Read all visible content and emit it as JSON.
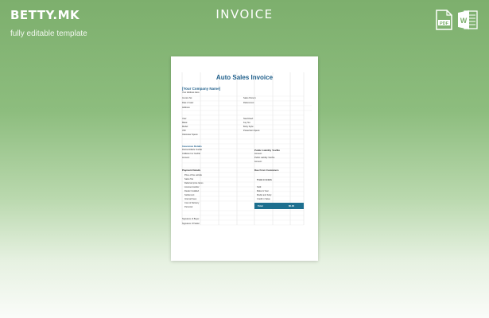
{
  "brand": {
    "logo": "BETTY.MK",
    "tagline": "fully editable template"
  },
  "page": {
    "title": "INVOICE"
  },
  "formats": {
    "pdf_label": "PDF",
    "word_label": "W"
  },
  "document": {
    "title": "Auto Sales Invoice",
    "company": "[Your Company Name]",
    "company_line": "Your Address Here",
    "invoice_no": "Invoice No:",
    "date_of_sale": "Date of sale:",
    "address": "Address:",
    "sales_person": "Sales Person:",
    "references": "References:",
    "year": "Year:",
    "make": "Make:",
    "model": "Model:",
    "vin": "VIN:",
    "odometer": "Odometer Specs:",
    "new_used": "New/Used:",
    "key_no": "Key No:",
    "body_style": "Body Style:",
    "powertrain": "Powertrain Specs:",
    "insurance_heading": "Insurance Details",
    "ins_line1": "Discount/Refs Yes/No",
    "ins_line2": "Collision Ins Yes/No",
    "ins_line3": "Amount:",
    "liab_line1": "Public Liability Yes/No",
    "liab_line2": "Amount:",
    "liab_line3": "Public Liability Yes/No",
    "liab_line4": "Amount:",
    "payment_heading": "Payment Details",
    "due_heading": "Due From Customers",
    "pay_items": [
      "Price of the vehicle",
      "Sales Tax",
      "Deferred price Items",
      "License transfer",
      "Dealer Installed",
      "Settlement",
      "Internal Fees",
      "Cost of Delivery",
      "Personal"
    ],
    "trade_heading": "Trade in details",
    "trade_items": [
      "Sold:",
      "Make & Year",
      "Model and body",
      "Credit in Value"
    ],
    "total_label": "Total",
    "total_value": "$0.00",
    "sig1": "Signature of Buyer",
    "sig2": "Signature Of Seller"
  },
  "colors": {
    "accent": "#1f5f8b",
    "total_bar": "#1d6f8f",
    "background_top": "#7daf6d"
  }
}
